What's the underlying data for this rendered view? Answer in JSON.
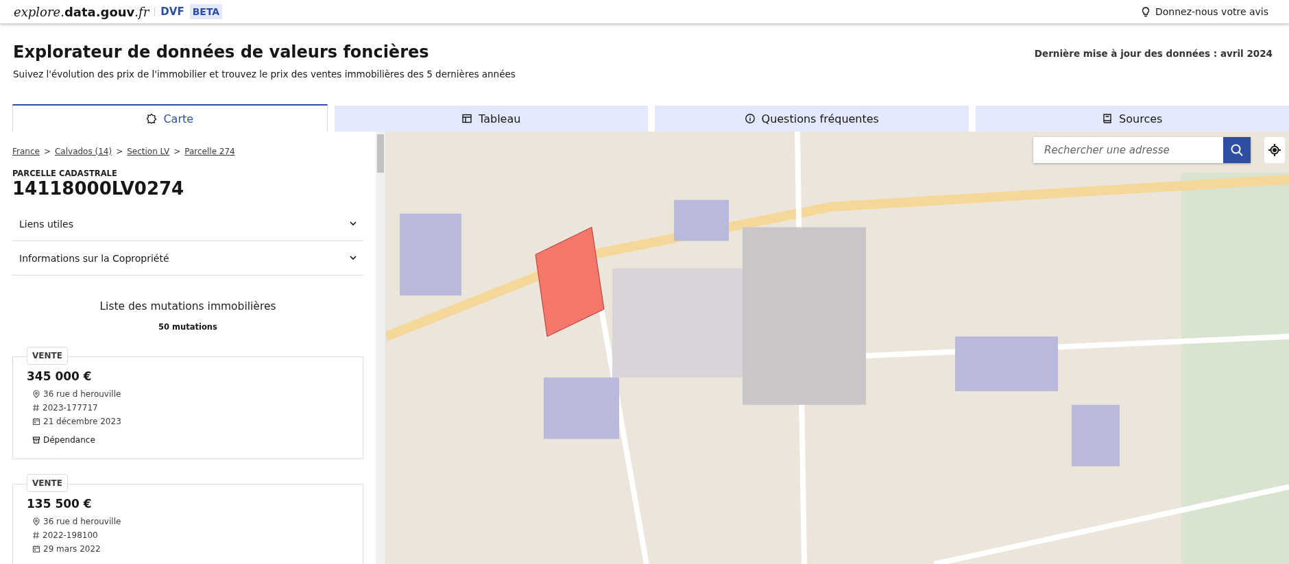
{
  "header": {
    "logo_prefix": "explore.",
    "logo_main": "data.gouv",
    "logo_suffix": ".fr",
    "product": "DVF",
    "badge": "BETA",
    "feedback": "Donnez-nous votre avis"
  },
  "page": {
    "title": "Explorateur de données de valeurs foncières",
    "subtitle": "Suivez l'évolution des prix de l'immobilier et trouvez le prix des ventes immobilières des 5 dernières années",
    "update": "Dernière mise à jour des données : avril 2024"
  },
  "tabs": [
    {
      "label": "Carte",
      "kind": "map",
      "selected": true
    },
    {
      "label": "Tableau",
      "kind": "table",
      "selected": false
    },
    {
      "label": "Questions fréquentes",
      "kind": "info",
      "selected": false
    },
    {
      "label": "Sources",
      "kind": "book",
      "selected": false
    }
  ],
  "sidebar": {
    "breadcrumb": [
      "France",
      "Calvados (14)",
      "Section LV",
      "Parcelle 274"
    ],
    "separator": ">",
    "overline": "PARCELLE CADASTRALE",
    "parcel_id": "14118000LV0274",
    "accordions": [
      {
        "label": "Liens utiles",
        "expanded": false
      },
      {
        "label": "Informations sur la Copropriété",
        "expanded": false
      }
    ],
    "list_title": "Liste des mutations immobilières",
    "count": "50 mutations",
    "mutations": [
      {
        "tag": "VENTE",
        "price": "345 000 €",
        "details": [
          {
            "kind": "address",
            "text": "36 rue d herouville"
          },
          {
            "kind": "id",
            "text": "2023-177717"
          },
          {
            "kind": "date",
            "text": "21 décembre 2023"
          }
        ],
        "types": [
          "Dépendance"
        ]
      },
      {
        "tag": "VENTE",
        "price": "135 500 €",
        "details": [
          {
            "kind": "address",
            "text": "36 rue d herouville"
          },
          {
            "kind": "id",
            "text": "2022-198100"
          },
          {
            "kind": "date",
            "text": "29 mars 2022"
          }
        ]
      }
    ]
  },
  "map": {
    "search": {
      "placeholder": "Rechercher une adresse"
    }
  }
}
